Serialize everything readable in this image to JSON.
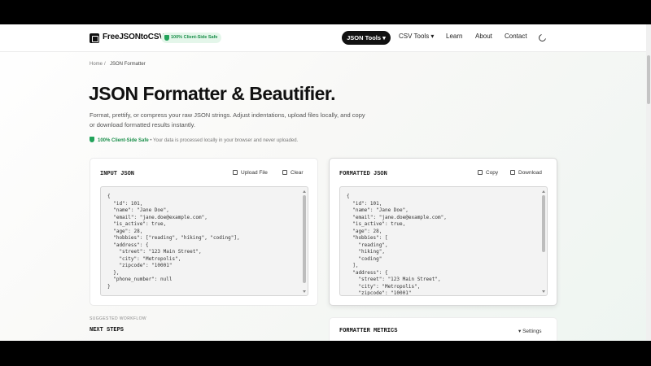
{
  "brand": {
    "name": "FreeJSONtoCSV",
    "badge": "100% Client-Side Safe"
  },
  "nav": {
    "json_tools": "JSON Tools ▾",
    "csv_tools": "CSV Tools ▾",
    "learn": "Learn",
    "about": "About",
    "contact": "Contact"
  },
  "breadcrumb": {
    "home": "Home",
    "sep": "/",
    "current": "JSON Formatter"
  },
  "hero": {
    "title": "JSON Formatter & Beautifier.",
    "description": "Format, prettify, or compress your raw JSON strings. Adjust indentations, upload files locally, and copy or download formatted results instantly.",
    "safe_label": "100% Client-Side Safe",
    "safe_text": " • Your data is processed locally in your browser and never uploaded."
  },
  "input_panel": {
    "title": "INPUT JSON",
    "upload_label": "Upload File",
    "clear_label": "Clear",
    "content": "{\n  \"id\": 101,\n  \"name\": \"Jane Doe\",\n  \"email\": \"jane.doe@example.com\",\n  \"is_active\": true,\n  \"age\": 28,\n  \"hobbies\": [\"reading\", \"hiking\", \"coding\"],\n  \"address\": {\n    \"street\": \"123 Main Street\",\n    \"city\": \"Metropolis\",\n    \"zipcode\": \"10001\"\n  },\n  \"phone_number\": null\n}"
  },
  "output_panel": {
    "title": "FORMATTED JSON",
    "copy_label": "Copy",
    "download_label": "Download",
    "content": "{\n  \"id\": 101,\n  \"name\": \"Jane Doe\",\n  \"email\": \"jane.doe@example.com\",\n  \"is_active\": true,\n  \"age\": 28,\n  \"hobbies\": [\n    \"reading\",\n    \"hiking\",\n    \"coding\"\n  ],\n  \"address\": {\n    \"street\": \"123 Main Street\",\n    \"city\": \"Metropolis\",\n    \"zipcode\": \"10001\""
  },
  "workflow": {
    "caption": "SUGGESTED WORKFLOW",
    "title": "NEXT STEPS"
  },
  "metrics": {
    "title": "FORMATTER METRICS",
    "settings_label": "▾ Settings"
  },
  "colors": {
    "accent": "#111111",
    "safe_green": "#22a35a"
  }
}
